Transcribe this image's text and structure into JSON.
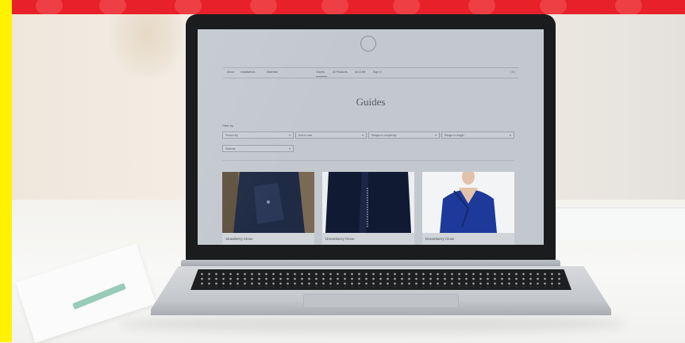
{
  "site": {
    "page_title": "Guides",
    "logo_text": "",
    "nav_items": [
      "About",
      "Installations",
      "Materials",
      "Guides",
      "All Products",
      "Art & Mfr",
      "Sign in"
    ],
    "cart_label": "( 0 )",
    "filter_label": "Filter by",
    "filters": [
      "Placed By",
      "Sort in size",
      "Range in complexity",
      "Range in length",
      "Material"
    ],
    "cards": [
      {
        "title": "Strawberry Close"
      },
      {
        "title": "Dreamberry Close"
      },
      {
        "title": "Dreamberry Close"
      }
    ]
  },
  "colors": {
    "side_bar": "#fff200",
    "banner": "#e8202a",
    "screen_background": "#c3c8cf"
  }
}
